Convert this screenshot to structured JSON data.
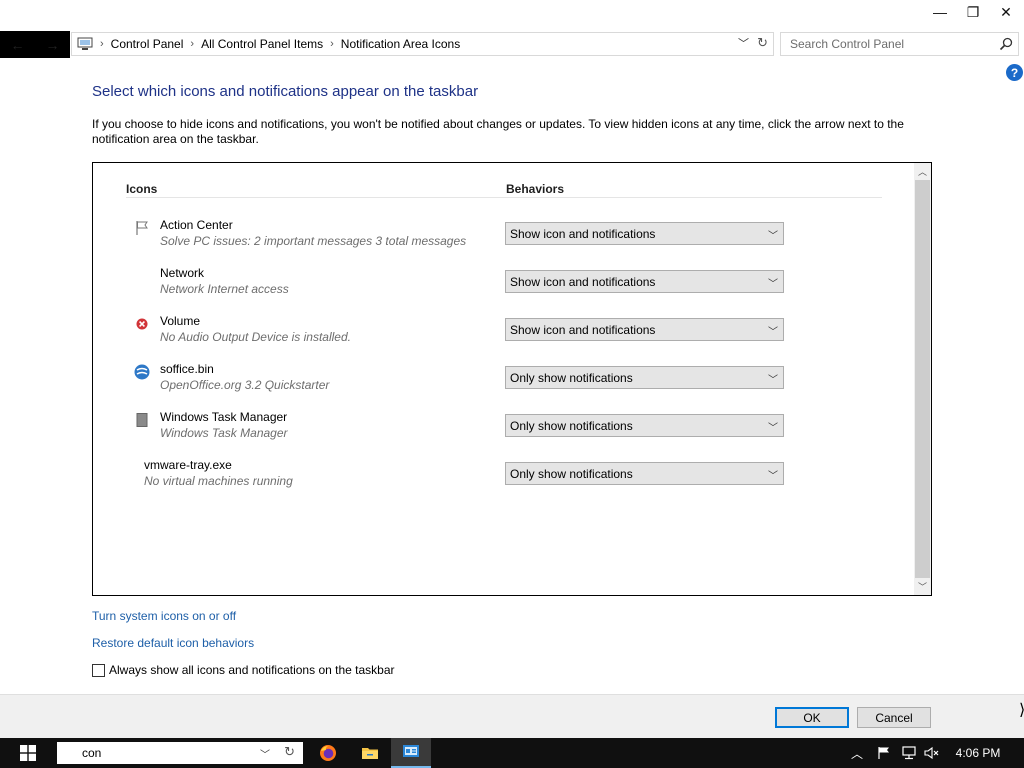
{
  "window": {
    "minimize": "—",
    "restore": "❐",
    "close": "✕"
  },
  "address": {
    "breadcrumbs": [
      "Control Panel",
      "All Control Panel Items",
      "Notification Area Icons"
    ]
  },
  "search": {
    "placeholder": "Search Control Panel"
  },
  "help_label": "?",
  "main": {
    "heading": "Select which icons and notifications appear on the taskbar",
    "description": "If you choose to hide icons and notifications, you won't be notified about changes or updates. To view hidden icons at any time, click the arrow next to the notification area on the taskbar.",
    "columns": {
      "icons": "Icons",
      "behaviors": "Behaviors"
    },
    "rows": [
      {
        "name": "Action Center",
        "sub": "Solve PC issues: 2 important messages  3 total messages",
        "behavior": "Show icon and notifications",
        "icon": "flag-icon"
      },
      {
        "name": "Network",
        "sub": "Network Internet access",
        "behavior": "Show icon and notifications",
        "icon": "none"
      },
      {
        "name": "Volume",
        "sub": "No Audio Output Device is installed.",
        "behavior": "Show icon and notifications",
        "icon": "volume-error-icon"
      },
      {
        "name": "soffice.bin",
        "sub": "OpenOffice.org 3.2 Quickstarter",
        "behavior": "Only show notifications",
        "icon": "openoffice-icon"
      },
      {
        "name": "Windows Task Manager",
        "sub": "Windows Task Manager",
        "behavior": "Only show notifications",
        "icon": "task-manager-icon"
      },
      {
        "name": "vmware-tray.exe",
        "sub": "No virtual machines running",
        "behavior": "Only show notifications",
        "icon": "none"
      }
    ],
    "links": {
      "system_icons": "Turn system icons on or off",
      "restore": "Restore default icon behaviors"
    },
    "always_show": {
      "label": "Always show all icons and notifications on the taskbar",
      "checked": false
    }
  },
  "footer": {
    "ok": "OK",
    "cancel": "Cancel"
  },
  "taskbar": {
    "search_value": "con",
    "clock": "4:06 PM"
  },
  "colors": {
    "heading": "#1e3287",
    "link": "#1e5fa8",
    "accent": "#0078d7"
  }
}
